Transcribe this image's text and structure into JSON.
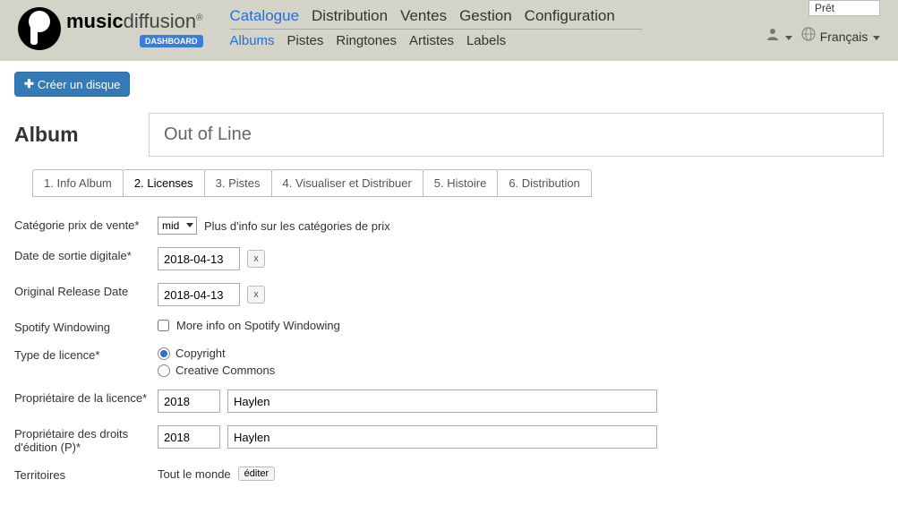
{
  "header": {
    "logo_text_bold": "music",
    "logo_text_light": "diffusion",
    "logo_reg": "®",
    "logo_badge": "DASHBOARD",
    "status": "Prêt",
    "language": "Français",
    "nav_primary": [
      "Catalogue",
      "Distribution",
      "Ventes",
      "Gestion",
      "Configuration"
    ],
    "nav_primary_active": 0,
    "nav_secondary": [
      "Albums",
      "Pistes",
      "Ringtones",
      "Artistes",
      "Labels"
    ],
    "nav_secondary_active": 0
  },
  "buttons": {
    "create_album": "Créer un disque"
  },
  "page": {
    "title": "Album",
    "album_title": "Out of Line"
  },
  "tabs": [
    "1. Info Album",
    "2. Licenses",
    "3. Pistes",
    "4. Visualiser et Distribuer",
    "5. Histoire",
    "6. Distribution"
  ],
  "tabs_active": 1,
  "form": {
    "price_category_label": "Catégorie prix de vente*",
    "price_category_value": "mid",
    "price_category_hint": "Plus d'info sur les catégories de prix",
    "digital_release_label": "Date de sortie digitale*",
    "digital_release_value": "2018-04-13",
    "original_release_label": "Original Release Date",
    "original_release_value": "2018-04-13",
    "clear_btn": "x",
    "spotify_windowing_label": "Spotify Windowing",
    "spotify_windowing_hint": "More info on Spotify Windowing",
    "license_type_label": "Type de licence*",
    "license_copyright": "Copyright",
    "license_cc": "Creative Commons",
    "license_owner_label": "Propriétaire de la licence*",
    "license_owner_year": "2018",
    "license_owner_name": "Haylen",
    "p_owner_label": "Propriétaire des droits d'édition (P)*",
    "p_owner_year": "2018",
    "p_owner_name": "Haylen",
    "territories_label": "Territoires",
    "territories_value": "Tout le monde",
    "edit_btn": "éditer"
  }
}
